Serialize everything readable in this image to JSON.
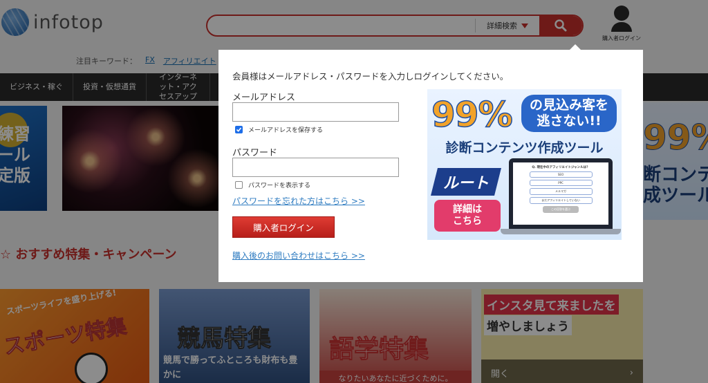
{
  "header": {
    "logo_text": "infotop",
    "search_placeholder": "",
    "advanced_search_label": "詳細検索",
    "user_label": "購入者ログイン"
  },
  "keywords": {
    "label": "注目キーワード：",
    "items": [
      "FX",
      "アフィリエイト"
    ]
  },
  "nav": {
    "items": [
      {
        "label": "ビジネス・稼ぐ"
      },
      {
        "label": "投資・仮想通貨"
      },
      {
        "label": "インターネット・アクセスアップ"
      }
    ]
  },
  "slides": {
    "left_text": "練習\nール\n定版",
    "right_big": "99%",
    "right_line1": "断コンテンツ",
    "right_line2": "成ツール"
  },
  "section": {
    "title": "☆ おすすめ特集・キャンペーン"
  },
  "banners": [
    {
      "title": "スポーツ特集",
      "sub": "スポーツライフを盛り上げる!"
    },
    {
      "title": "競馬特集",
      "sub": "競馬で勝ってふところも財布も豊かに"
    },
    {
      "title": "語学特集",
      "sub": "なりたいあなたに近づくために。"
    },
    {
      "title": "インスタ見て来ましたを",
      "title2": "増やしましょう",
      "sub": "開く"
    }
  ],
  "modal": {
    "instruction": "会員様はメールアドレス・パスワードを入力しログインしてください。",
    "email_label": "メールアドレス",
    "email_value": "",
    "save_email_label": "メールアドレスを保存する",
    "save_email_checked": true,
    "password_label": "パスワード",
    "password_value": "",
    "show_password_label": "パスワードを表示する",
    "show_password_checked": false,
    "forgot_link": "パスワードを忘れた方はこちら >>",
    "login_button": "購入者ログイン",
    "contact_link": "購入後のお問い合わせはこちら >>"
  },
  "ad": {
    "percent": "99%",
    "bubble_line1": "の見込み客を",
    "bubble_line2": "逃さない!!",
    "subtitle": "診断コンテンツ作成ツール",
    "logo": "ルート",
    "cta_line1": "詳細は",
    "cta_line2": "こちら",
    "screen_title": "Q. 現在中のアフィリエイトジャンルは？",
    "screen_options": [
      "SEO",
      "PPC",
      "メルマガ",
      "まだアフィリエイトしていない"
    ],
    "screen_button": "この回答を選ぶ"
  },
  "colors": {
    "accent": "#c9302c",
    "link": "#2f7cc1",
    "overlay": "rgba(0,0,0,0.45)"
  }
}
